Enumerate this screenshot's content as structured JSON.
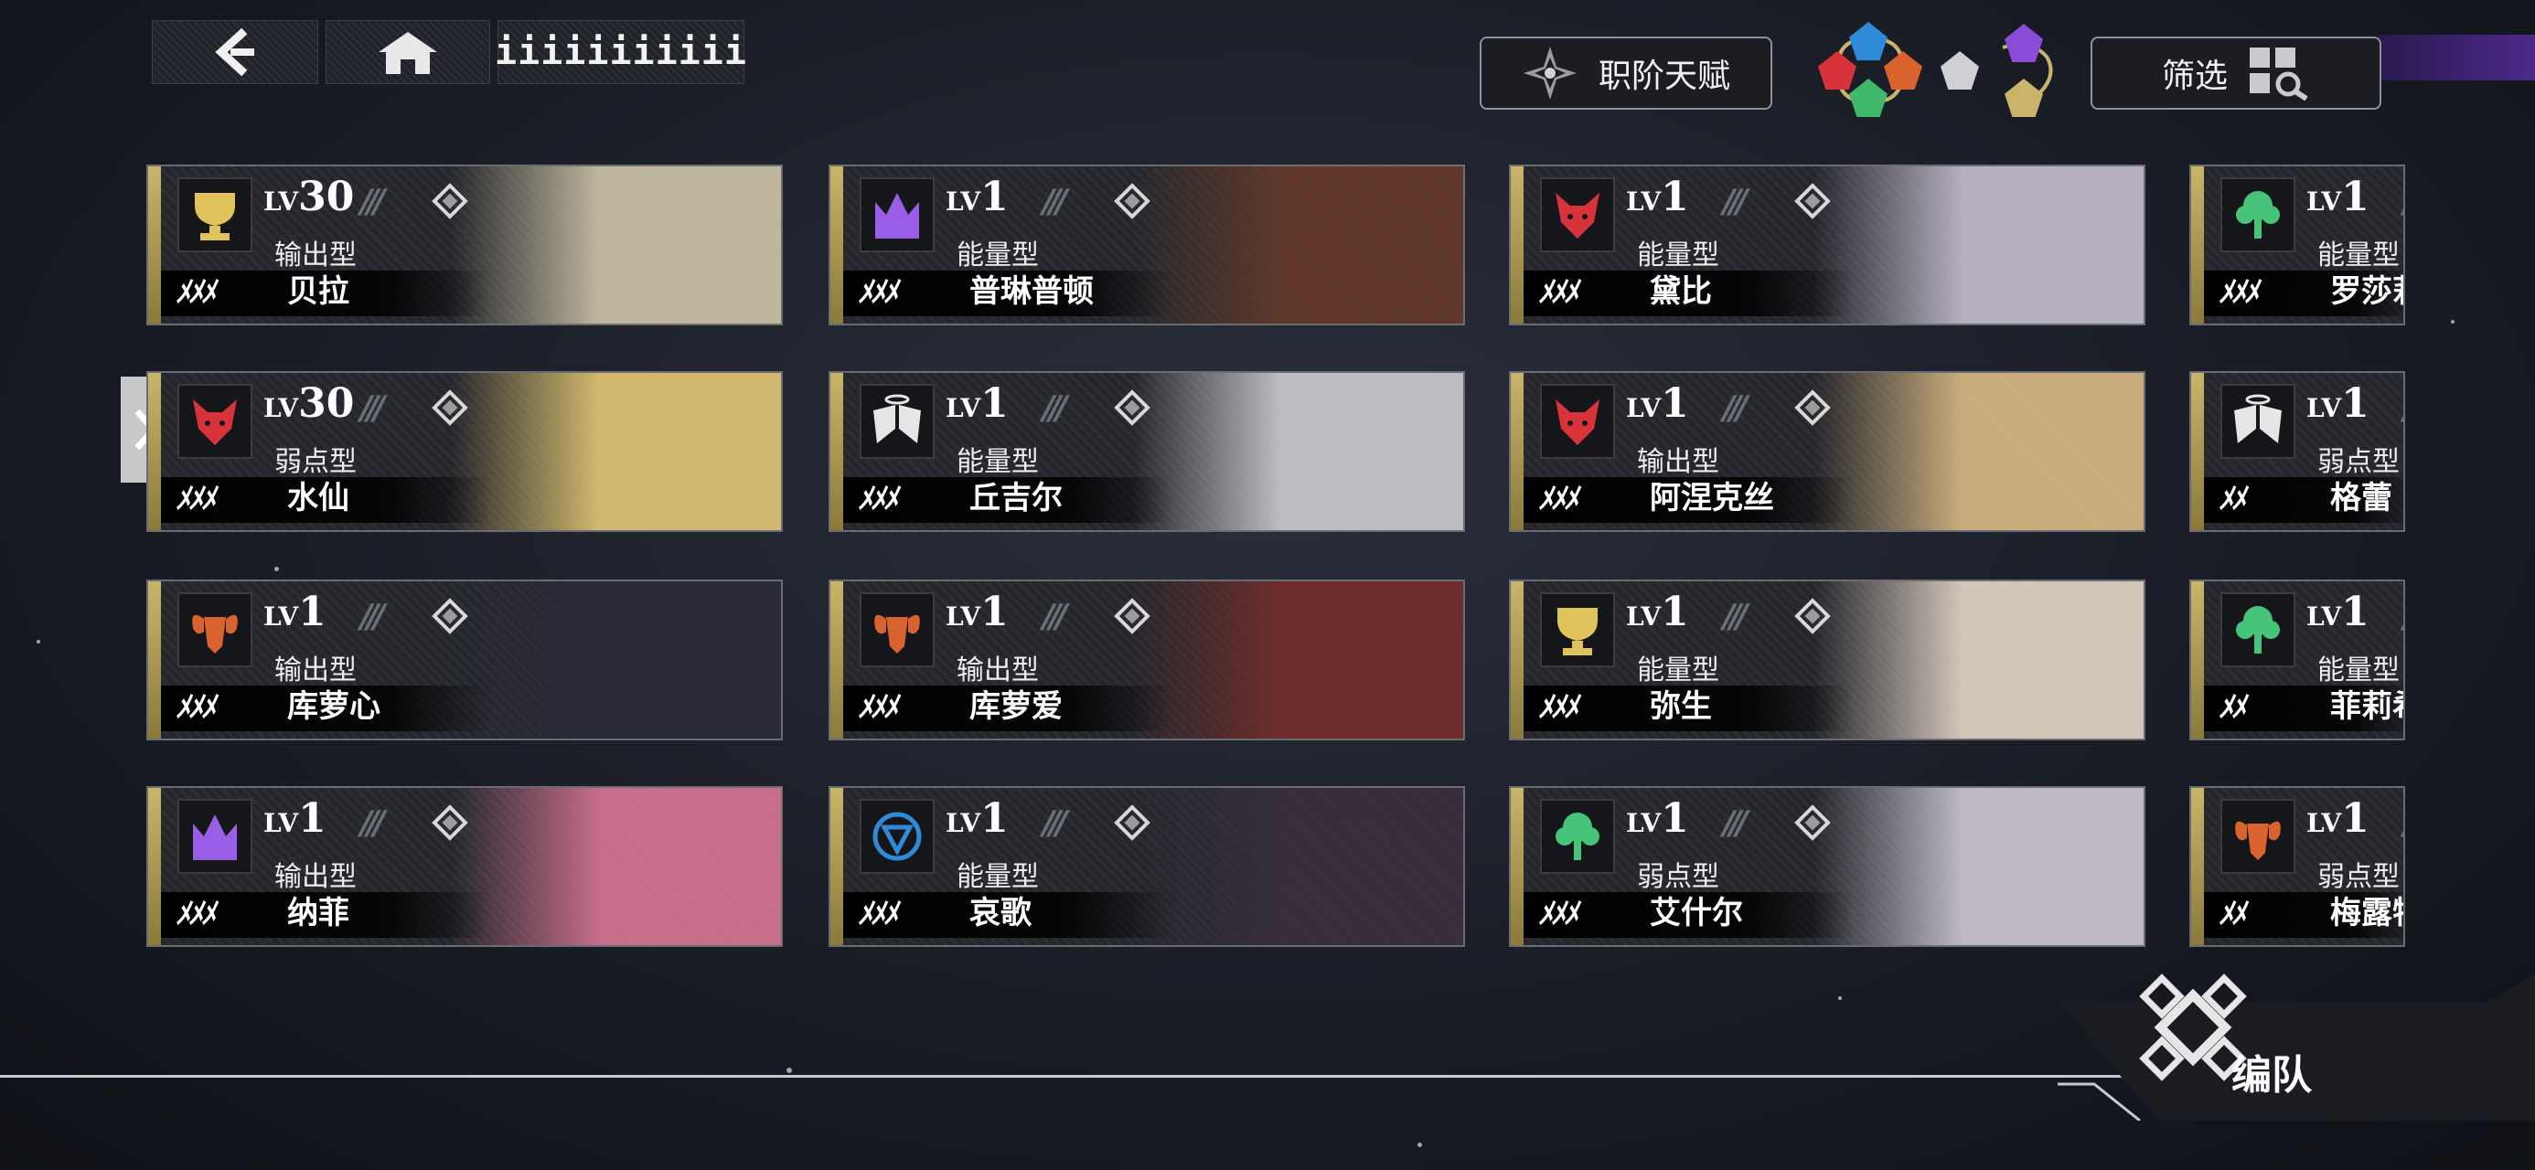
{
  "header": {
    "id_text": "iiiiiiiiiii",
    "class_talent_label": "职阶天赋",
    "filter_label": "筛选"
  },
  "footer": {
    "team_label": "编队"
  },
  "colors": {
    "gold": "#c9b46a",
    "red": "#d8323a",
    "purple": "#8a4bd8",
    "green": "#3fb86a",
    "blue": "#2f8bd8",
    "orange": "#d9632e",
    "white": "#e6e6e6",
    "accent_violet": "#4b2a8a"
  },
  "cards": [
    {
      "level_prefix": "LV",
      "level": "30",
      "type": "输出型",
      "name": "贝拉",
      "emblem": "gold-trophy-icon",
      "emblem_color": "#e0c35a",
      "stars": "ﾒﾒﾒ",
      "portrait_color": "#d9cfb0"
    },
    {
      "level_prefix": "LV",
      "level": "1",
      "type": "能量型",
      "name": "普琳普顿",
      "emblem": "purple-crown-icon",
      "emblem_color": "#9a5de6",
      "stars": "ﾒﾒﾒ",
      "portrait_color": "#6b3b2a"
    },
    {
      "level_prefix": "LV",
      "level": "1",
      "type": "能量型",
      "name": "黛比",
      "emblem": "red-wolf-icon",
      "emblem_color": "#d8323a",
      "stars": "ﾒﾒﾒ",
      "portrait_color": "#cfc6d8"
    },
    {
      "level_prefix": "LV",
      "level": "1",
      "type": "能量型",
      "name": "罗莎莉",
      "emblem": "green-tree-icon",
      "emblem_color": "#46c479",
      "stars": "ﾒﾒﾒ",
      "portrait_color": "#444"
    },
    {
      "level_prefix": "LV",
      "level": "30",
      "type": "弱点型",
      "name": "水仙",
      "emblem": "red-wolf-icon",
      "emblem_color": "#d8323a",
      "stars": "ﾒﾒﾒ",
      "portrait_color": "#f0d27a"
    },
    {
      "level_prefix": "LV",
      "level": "1",
      "type": "能量型",
      "name": "丘吉尔",
      "emblem": "white-wings-icon",
      "emblem_color": "#e6e6e6",
      "stars": "ﾒﾒﾒ",
      "portrait_color": "#d8d8de"
    },
    {
      "level_prefix": "LV",
      "level": "1",
      "type": "输出型",
      "name": "阿涅克丝",
      "emblem": "red-wolf-icon",
      "emblem_color": "#d8323a",
      "stars": "ﾒﾒﾒ",
      "portrait_color": "#e6c48a"
    },
    {
      "level_prefix": "LV",
      "level": "1",
      "type": "弱点型",
      "name": "格蕾",
      "emblem": "white-wings-icon",
      "emblem_color": "#e6e6e6",
      "stars": "ﾒﾒ",
      "portrait_color": "#444"
    },
    {
      "level_prefix": "LV",
      "level": "1",
      "type": "输出型",
      "name": "库萝心",
      "emblem": "orange-ram-icon",
      "emblem_color": "#d9632e",
      "stars": "ﾒﾒﾒ",
      "portrait_color": "#2b2a3a"
    },
    {
      "level_prefix": "LV",
      "level": "1",
      "type": "输出型",
      "name": "库萝爱",
      "emblem": "orange-ram-icon",
      "emblem_color": "#d9632e",
      "stars": "ﾒﾒﾒ",
      "portrait_color": "#7a2e2a"
    },
    {
      "level_prefix": "LV",
      "level": "1",
      "type": "能量型",
      "name": "弥生",
      "emblem": "gold-trophy-icon",
      "emblem_color": "#e0c35a",
      "stars": "ﾒﾒﾒ",
      "portrait_color": "#efe2d2"
    },
    {
      "level_prefix": "LV",
      "level": "1",
      "type": "能量型",
      "name": "菲莉希",
      "emblem": "green-tree-icon",
      "emblem_color": "#46c479",
      "stars": "ﾒﾒ",
      "portrait_color": "#444"
    },
    {
      "level_prefix": "LV",
      "level": "1",
      "type": "输出型",
      "name": "纳菲",
      "emblem": "purple-crown-icon",
      "emblem_color": "#9a5de6",
      "stars": "ﾒﾒﾒ",
      "portrait_color": "#e27a9a"
    },
    {
      "level_prefix": "LV",
      "level": "1",
      "type": "能量型",
      "name": "哀歌",
      "emblem": "blue-shield-icon",
      "emblem_color": "#2f8bd8",
      "stars": "ﾒﾒﾒ",
      "portrait_color": "#3a2e3e"
    },
    {
      "level_prefix": "LV",
      "level": "1",
      "type": "弱点型",
      "name": "艾什尔",
      "emblem": "green-tree-icon",
      "emblem_color": "#46c479",
      "stars": "ﾒﾒﾒ",
      "portrait_color": "#d8d2de"
    },
    {
      "level_prefix": "LV",
      "level": "1",
      "type": "弱点型",
      "name": "梅露特",
      "emblem": "orange-ram-icon",
      "emblem_color": "#d9632e",
      "stars": "ﾒﾒ",
      "portrait_color": "#444"
    }
  ]
}
